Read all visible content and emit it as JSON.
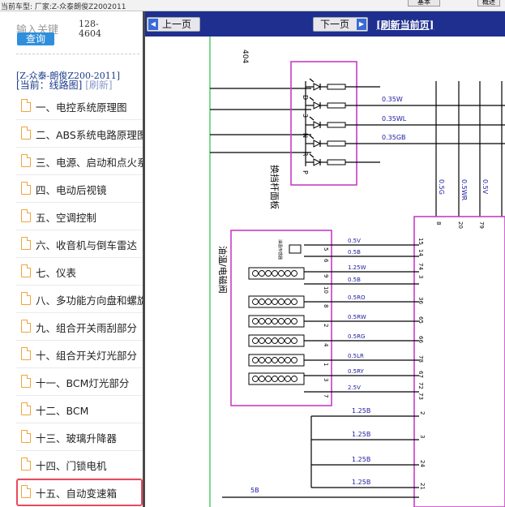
{
  "topbar": {
    "model_label": "当前车型:  厂家:Z-众泰朗俊Z2002011",
    "tab1": "基本",
    "tab2": "概述"
  },
  "sidebar": {
    "keyword_placeholder": "输入关键",
    "search_button": "查询",
    "count_line1": "128-",
    "count_line2": "4604",
    "model_title": "[Z-众泰-朗俊Z200-2011]",
    "current_label": "[当前：线路图]",
    "refresh_label": "[刷新]",
    "items": [
      {
        "label": "一、电控系统原理图"
      },
      {
        "label": "二、ABS系统电路原理图"
      },
      {
        "label": "三、电源、启动和点火系统"
      },
      {
        "label": "四、电动后视镜"
      },
      {
        "label": "五、空调控制"
      },
      {
        "label": "六、收音机与倒车雷达"
      },
      {
        "label": "七、仪表"
      },
      {
        "label": "八、多功能方向盘和螺旋"
      },
      {
        "label": "九、组合开关雨刮部分"
      },
      {
        "label": "十、组合开关灯光部分"
      },
      {
        "label": "十一、BCM灯光部分"
      },
      {
        "label": "十二、BCM"
      },
      {
        "label": "十三、玻璃升降器"
      },
      {
        "label": "十四、门锁电机"
      },
      {
        "label": "十五、自动变速箱"
      }
    ],
    "active_index": 14
  },
  "viewer": {
    "prev_label": "上一页",
    "next_label": "下一页",
    "refresh_label": "[刷新当前页]"
  },
  "diagram": {
    "top_left_code": "404",
    "gear_letters": [
      "D",
      "3",
      "N",
      "R",
      "P"
    ],
    "upper_wires": [
      "0.35W",
      "0.35WL",
      "0.35GB"
    ],
    "panel_label": "换挡杆面板",
    "vertical_wires": [
      "0.5G",
      "0.5WR",
      "0.5V",
      "0.5"
    ],
    "connector_pins_top": [
      "8",
      "20",
      "79"
    ],
    "valve_label": "油温/电磁阀",
    "valve_pins": [
      "5",
      "6",
      "9",
      "10",
      "8",
      "2",
      "4",
      "1",
      "3",
      "7"
    ],
    "valve_wires": [
      "0.5V",
      "0.5B",
      "1.25W",
      "0.5B",
      "0.5RO",
      "0.5RW",
      "0.5RG",
      "0.5LR",
      "0.5RY",
      "2.5V"
    ],
    "right_pins": [
      "15",
      "14",
      "74",
      "3",
      "36",
      "65",
      "66",
      "78",
      "67",
      "72",
      "73"
    ],
    "ground_wires": [
      "1.25B",
      "1.25B",
      "1.25B",
      "1.25B"
    ],
    "ground_pins": [
      "2",
      "3",
      "24",
      "21"
    ],
    "ground_main": "5B",
    "small_label": "油温传感器",
    "colors": {
      "wire": "#1a1aa0",
      "box": "#c63ec6",
      "green_line": "#2bbd4a",
      "nav": "#1f2f8f",
      "active": "#e84a5f"
    }
  }
}
